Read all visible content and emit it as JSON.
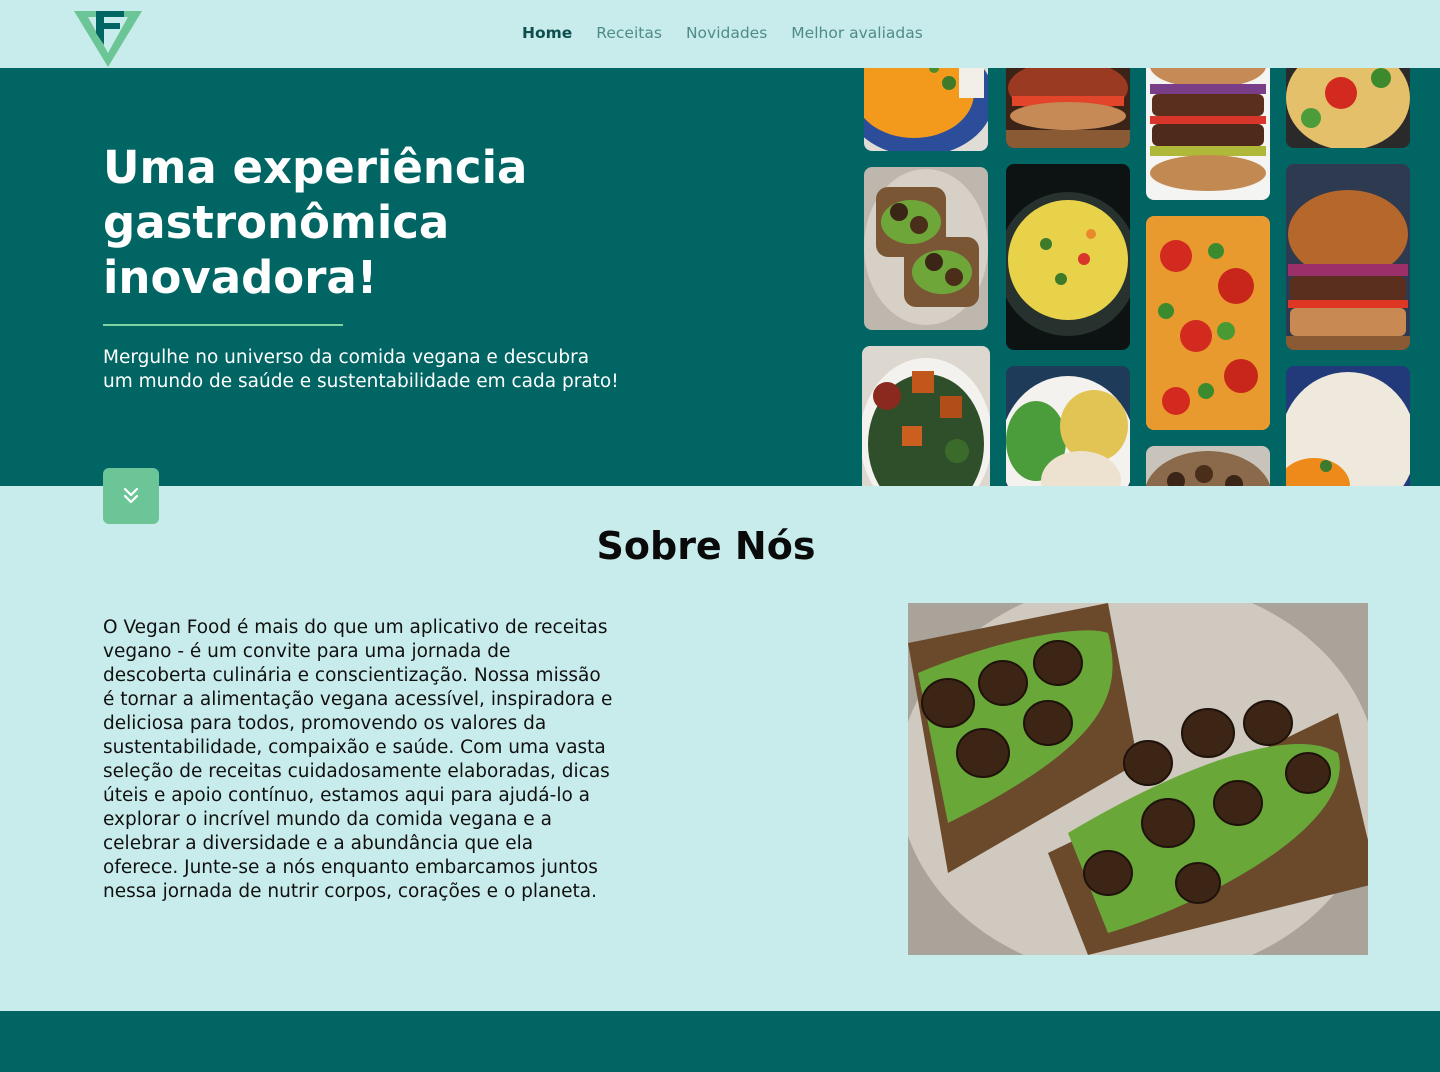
{
  "nav": {
    "items": [
      {
        "label": "Home",
        "active": true
      },
      {
        "label": "Receitas",
        "active": false
      },
      {
        "label": "Novidades",
        "active": false
      },
      {
        "label": "Melhor avaliadas",
        "active": false
      }
    ]
  },
  "hero": {
    "title": "Uma experiência gastronômica inovadora!",
    "subtitle": "Mergulhe no universo da comida vegana e descubra um mundo de saúde e sustentabilidade em cada prato!"
  },
  "about": {
    "title": "Sobre Nós",
    "text": "O Vegan Food é mais do que um aplicativo de receitas vegano - é um convite para uma jornada de descoberta culinária e conscientização. Nossa missão é tornar a alimentação vegana acessível, inspiradora e deliciosa para todos, promovendo os valores da sustentabilidade, compaixão e saúde. Com uma vasta seleção de receitas cuidadosamente elaboradas, dicas úteis e apoio contínuo, estamos aqui para ajudá-lo a explorar o incrível mundo da comida vegana e a celebrar a diversidade e a abundância que ela oferece. Junte-se a nós enquanto embarcamos juntos nessa jornada de nutrir corpos, corações e o planeta."
  },
  "icons": {
    "logo": "vf-logo",
    "scroll": "double-chevron-down-icon"
  },
  "colors": {
    "background": "#c8eceb",
    "primary": "#016564",
    "accent": "#6cc597",
    "nav_active": "#0c4f4e",
    "nav_inactive": "#4e8c8a"
  }
}
